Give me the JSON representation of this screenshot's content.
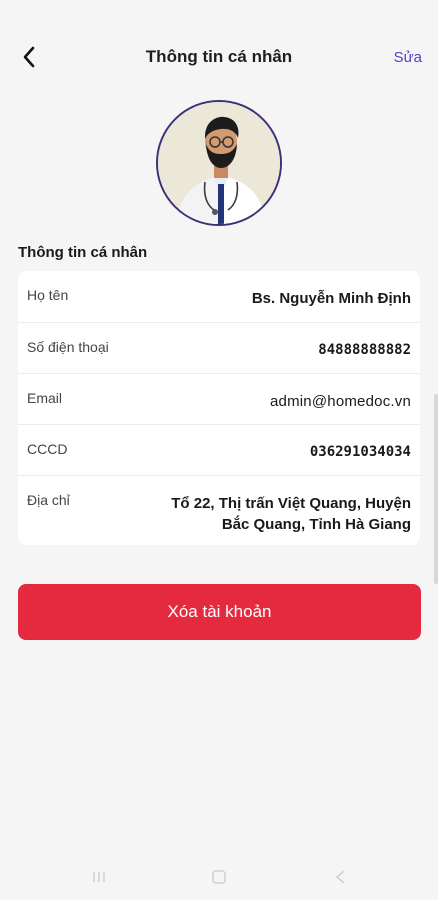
{
  "header": {
    "title": "Thông tin cá nhân",
    "edit_label": "Sửa"
  },
  "section": {
    "title": "Thông tin cá nhân"
  },
  "info": [
    {
      "label": "Họ tên",
      "value": "Bs. Nguyễn Minh Định"
    },
    {
      "label": "Số điện thoại",
      "value": "84888888882"
    },
    {
      "label": "Email",
      "value": "admin@homedoc.vn"
    },
    {
      "label": "CCCD",
      "value": "036291034034"
    },
    {
      "label": "Địa chỉ",
      "value": "Tổ 22, Thị trấn Việt Quang, Huyện Bắc Quang, Tỉnh Hà Giang"
    }
  ],
  "actions": {
    "delete_label": "Xóa tài khoản"
  },
  "colors": {
    "accent": "#5a3fc0",
    "danger": "#e5293f",
    "background": "#f5f5f5"
  },
  "icons": {
    "back": "chevron-left-icon",
    "nav_recent": "recent-apps-icon",
    "nav_home": "home-icon",
    "nav_back": "back-triangle-icon"
  }
}
